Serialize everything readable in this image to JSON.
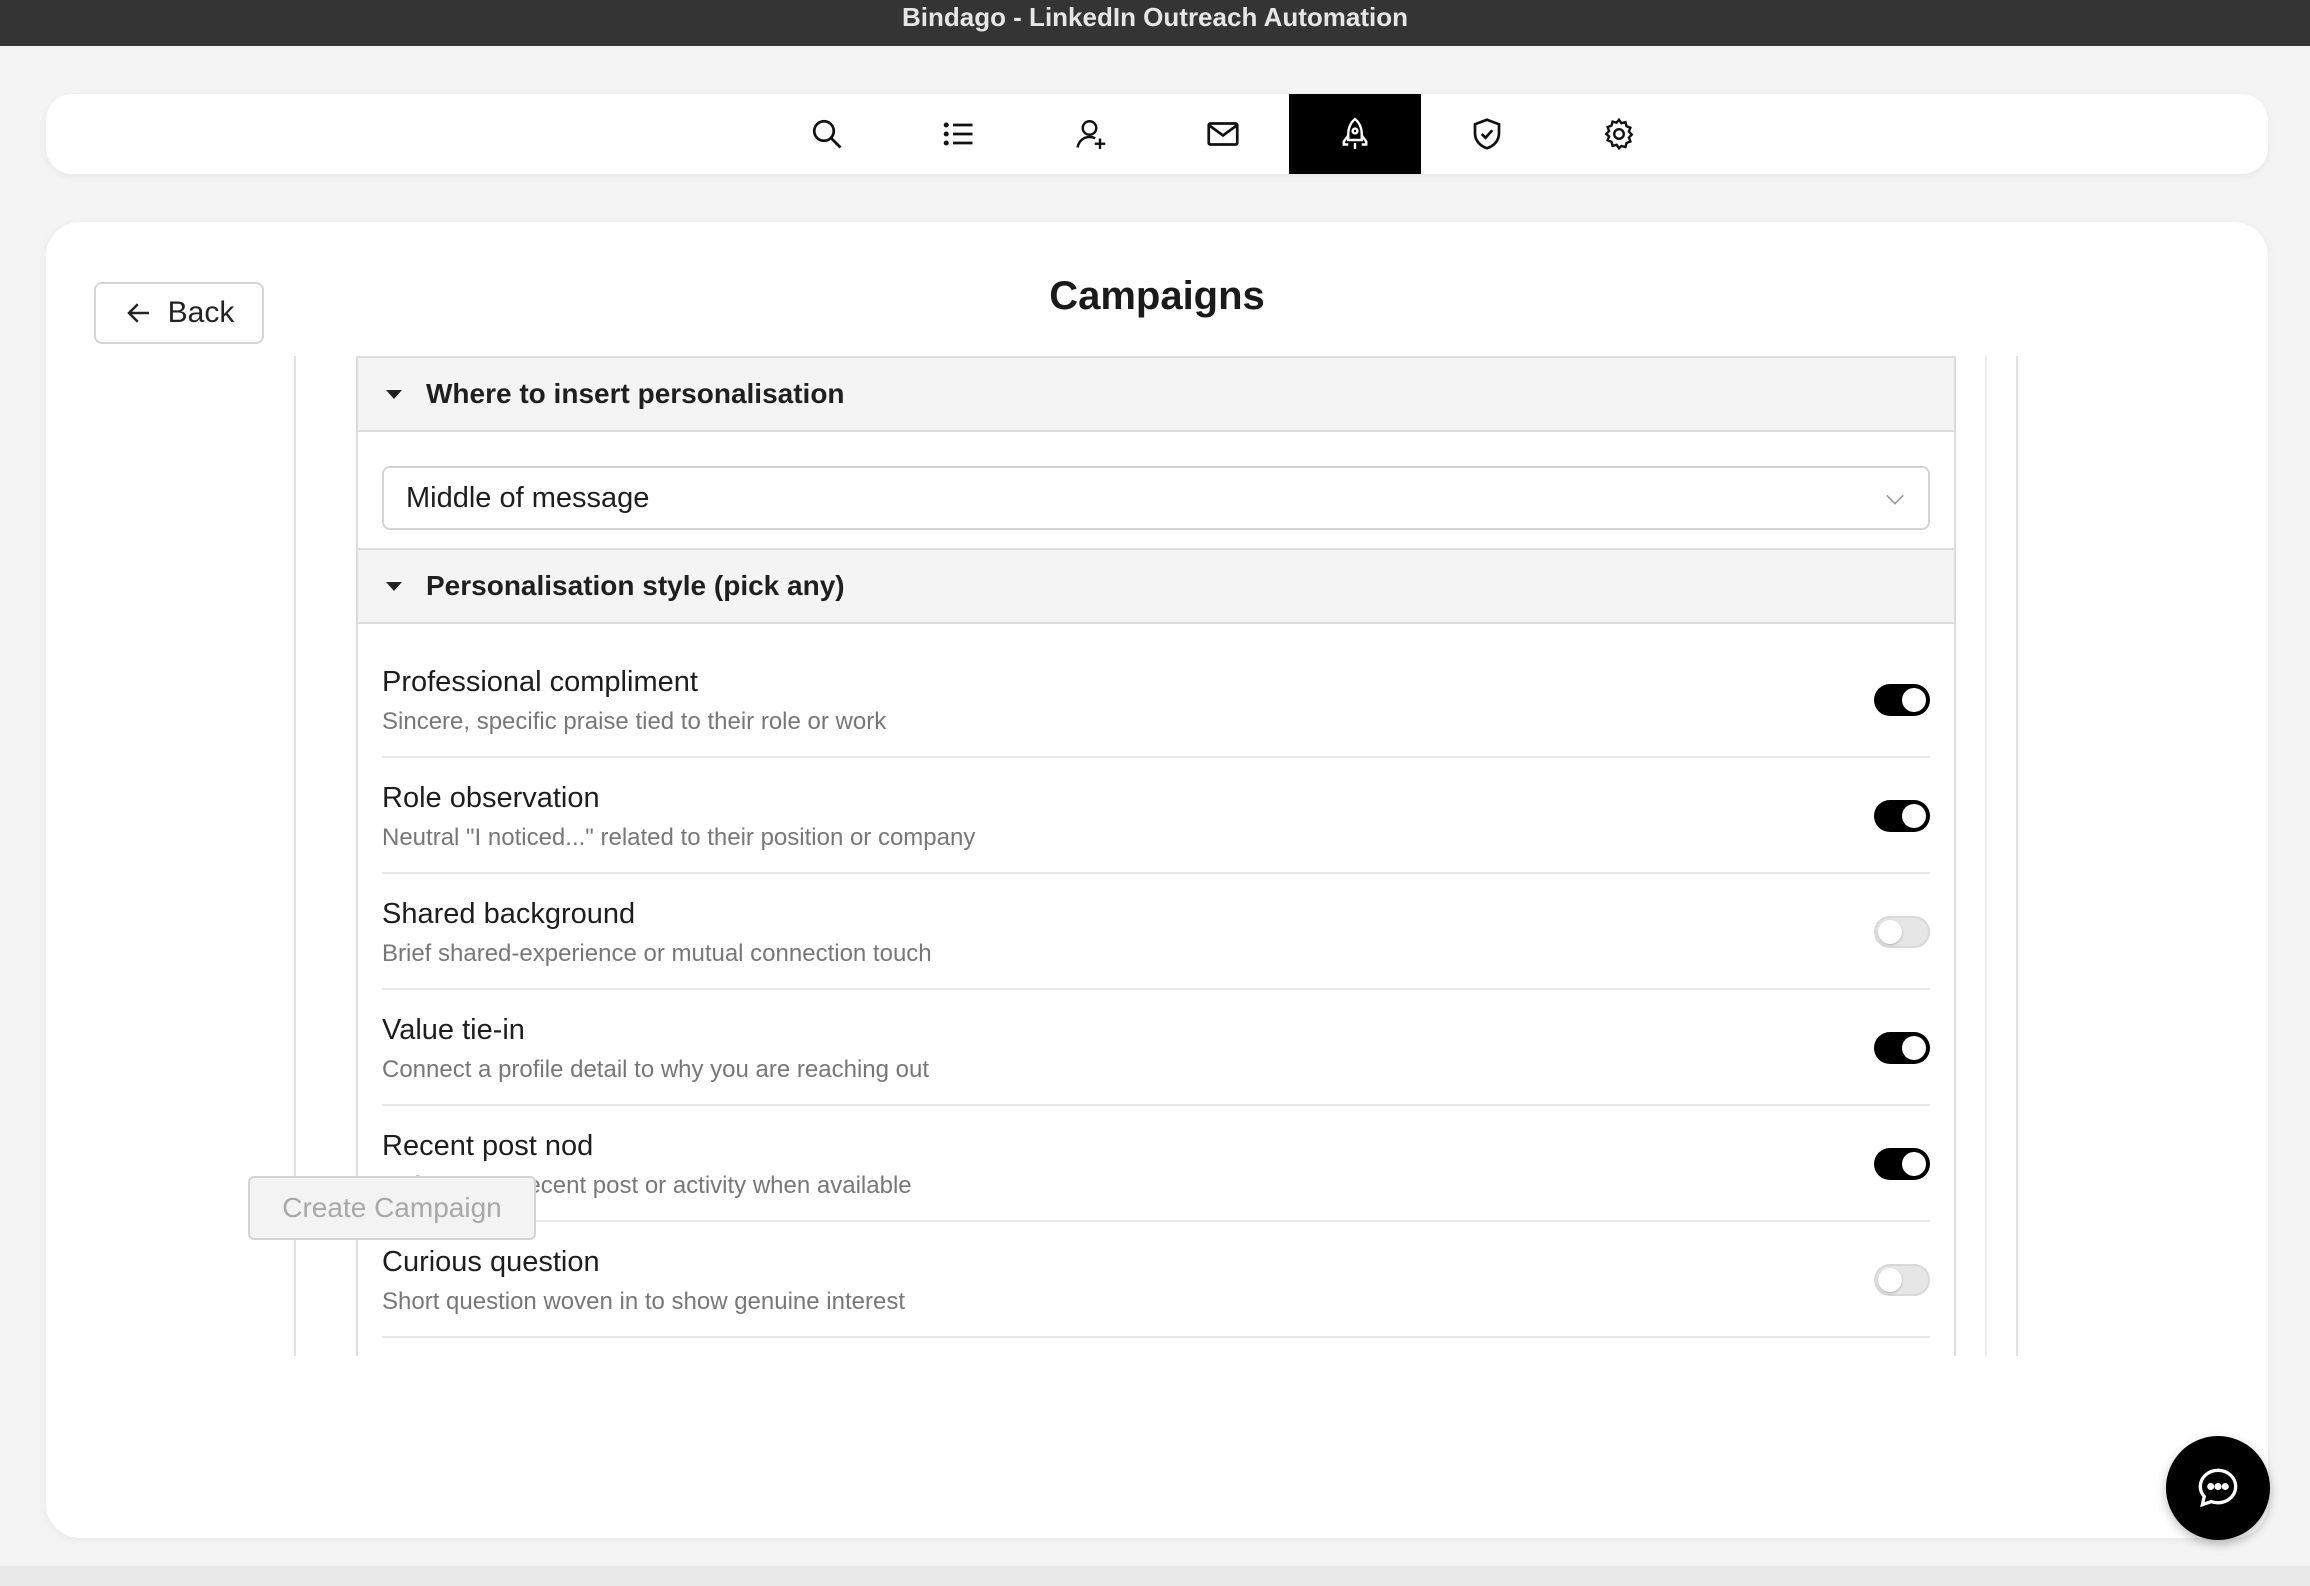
{
  "window": {
    "title": "Bindago - LinkedIn Outreach Automation"
  },
  "nav": {
    "active_index": 4,
    "items": [
      {
        "icon": "search-icon"
      },
      {
        "icon": "list-icon"
      },
      {
        "icon": "add-person-icon"
      },
      {
        "icon": "mail-icon"
      },
      {
        "icon": "rocket-icon"
      },
      {
        "icon": "shield-check-icon"
      },
      {
        "icon": "gear-icon"
      }
    ]
  },
  "page": {
    "title": "Campaigns",
    "back_label": "Back"
  },
  "insert_section": {
    "title": "Where to insert personalisation",
    "selected": "Middle of message"
  },
  "style_section": {
    "title": "Personalisation style (pick any)",
    "options": [
      {
        "label": "Professional compliment",
        "description": "Sincere, specific praise tied to their role or work",
        "enabled": true
      },
      {
        "label": "Role observation",
        "description": "Neutral \"I noticed...\" related to their position or company",
        "enabled": true
      },
      {
        "label": "Shared background",
        "description": "Brief shared-experience or mutual connection touch",
        "enabled": false
      },
      {
        "label": "Value tie-in",
        "description": "Connect a profile detail to why you are reaching out",
        "enabled": true
      },
      {
        "label": "Recent post nod",
        "description": "Reference a recent post or activity when available",
        "enabled": true
      },
      {
        "label": "Curious question",
        "description": "Short question woven in to show genuine interest",
        "enabled": false
      }
    ]
  },
  "footer": {
    "create_label": "Create Campaign"
  },
  "colors": {
    "accent": "#000000",
    "toggle_off": "#e6e6e6",
    "section_bg": "#f4f4f4"
  }
}
